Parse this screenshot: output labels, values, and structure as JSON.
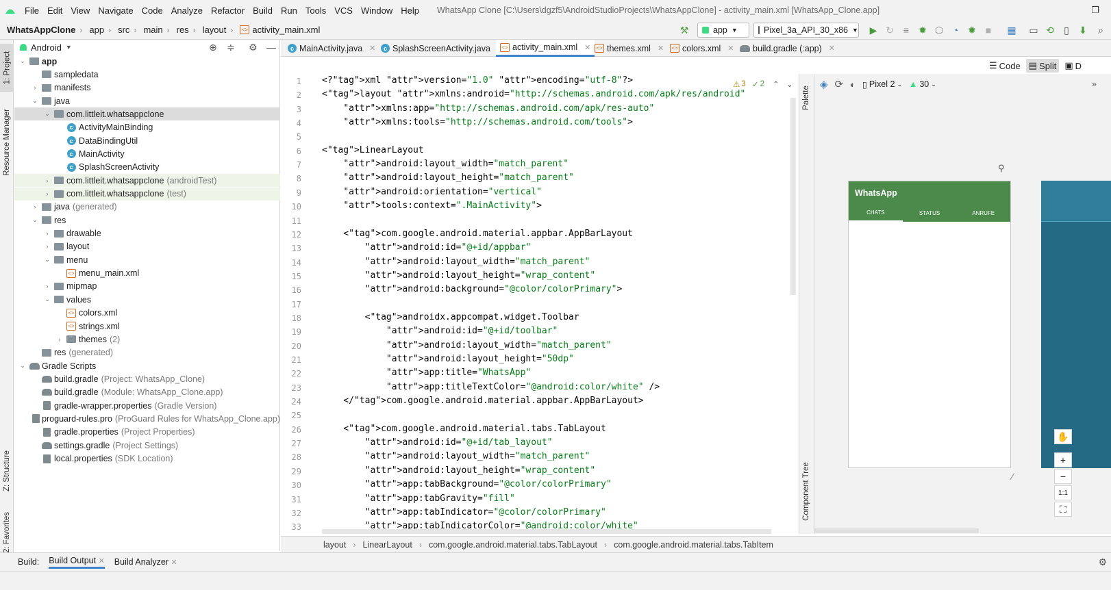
{
  "menubar": {
    "items": [
      "File",
      "Edit",
      "View",
      "Navigate",
      "Code",
      "Analyze",
      "Refactor",
      "Build",
      "Run",
      "Tools",
      "VCS",
      "Window",
      "Help"
    ],
    "window_title": "WhatsApp Clone [C:\\Users\\dgzf5\\AndroidStudioProjects\\WhatsAppClone] - activity_main.xml [WhatsApp_Clone.app]"
  },
  "navbar": {
    "crumbs": [
      "WhatsAppClone",
      "app",
      "src",
      "main",
      "res",
      "layout",
      "activity_main.xml"
    ],
    "run_config": "app",
    "device": "Pixel_3a_API_30_x86"
  },
  "leftstrip": {
    "tabs": [
      "1: Project",
      "Resource Manager",
      "Z: Structure",
      "2: Favorites"
    ]
  },
  "project": {
    "view": "Android",
    "tree": [
      {
        "label": "app",
        "hint": "",
        "icon": "folder-icon",
        "arrow": "open"
      },
      {
        "label": "sampledata",
        "hint": "",
        "icon": "folder-icon",
        "arrow": ""
      },
      {
        "label": "manifests",
        "hint": "",
        "icon": "folder-icon",
        "arrow": "closed"
      },
      {
        "label": "java",
        "hint": "",
        "icon": "folder-icon",
        "arrow": "open"
      },
      {
        "label": "com.littleit.whatsappclone",
        "hint": "",
        "icon": "package-icon",
        "arrow": "open"
      },
      {
        "label": "ActivityMainBinding",
        "hint": "",
        "icon": "class-icon",
        "arrow": ""
      },
      {
        "label": "DataBindingUtil",
        "hint": "",
        "icon": "class-icon",
        "arrow": ""
      },
      {
        "label": "MainActivity",
        "hint": "",
        "icon": "class-icon",
        "arrow": ""
      },
      {
        "label": "SplashScreenActivity",
        "hint": "",
        "icon": "class-icon",
        "arrow": ""
      },
      {
        "label": "com.littleit.whatsappclone",
        "hint": "(androidTest)",
        "icon": "package-icon",
        "arrow": "closed"
      },
      {
        "label": "com.littleit.whatsappclone",
        "hint": "(test)",
        "icon": "package-icon",
        "arrow": "closed"
      },
      {
        "label": "java",
        "hint": "(generated)",
        "icon": "folder-icon",
        "arrow": "closed"
      },
      {
        "label": "res",
        "hint": "",
        "icon": "folder-icon",
        "arrow": "open"
      },
      {
        "label": "drawable",
        "hint": "",
        "icon": "folder-icon",
        "arrow": "closed"
      },
      {
        "label": "layout",
        "hint": "",
        "icon": "folder-icon",
        "arrow": "closed"
      },
      {
        "label": "menu",
        "hint": "",
        "icon": "folder-icon",
        "arrow": "open"
      },
      {
        "label": "menu_main.xml",
        "hint": "",
        "icon": "xml-icon",
        "arrow": ""
      },
      {
        "label": "mipmap",
        "hint": "",
        "icon": "folder-icon",
        "arrow": "closed"
      },
      {
        "label": "values",
        "hint": "",
        "icon": "folder-icon",
        "arrow": "open"
      },
      {
        "label": "colors.xml",
        "hint": "",
        "icon": "xml-icon",
        "arrow": ""
      },
      {
        "label": "strings.xml",
        "hint": "",
        "icon": "xml-icon",
        "arrow": ""
      },
      {
        "label": "themes",
        "hint": "(2)",
        "icon": "folder-icon",
        "arrow": "closed"
      },
      {
        "label": "res",
        "hint": "(generated)",
        "icon": "folder-icon",
        "arrow": ""
      },
      {
        "label": "Gradle Scripts",
        "hint": "",
        "icon": "gradle-icon",
        "arrow": "open"
      },
      {
        "label": "build.gradle",
        "hint": "(Project: WhatsApp_Clone)",
        "icon": "gradle-icon",
        "arrow": ""
      },
      {
        "label": "build.gradle",
        "hint": "(Module: WhatsApp_Clone.app)",
        "icon": "gradle-icon",
        "arrow": ""
      },
      {
        "label": "gradle-wrapper.properties",
        "hint": "(Gradle Version)",
        "icon": "file-icon",
        "arrow": ""
      },
      {
        "label": "proguard-rules.pro",
        "hint": "(ProGuard Rules for WhatsApp_Clone.app)",
        "icon": "file-icon",
        "arrow": ""
      },
      {
        "label": "gradle.properties",
        "hint": "(Project Properties)",
        "icon": "file-icon",
        "arrow": ""
      },
      {
        "label": "settings.gradle",
        "hint": "(Project Settings)",
        "icon": "gradle-icon",
        "arrow": ""
      },
      {
        "label": "local.properties",
        "hint": "(SDK Location)",
        "icon": "file-icon",
        "arrow": ""
      }
    ]
  },
  "editor": {
    "tabs": [
      "MainActivity.java",
      "SplashScreenActivity.java",
      "activity_main.xml",
      "themes.xml",
      "colors.xml",
      "build.gradle (:app)"
    ],
    "active_tab": "activity_main.xml",
    "warnings": "3",
    "checks": "2",
    "lines": [
      "<?xml version=\"1.0\" encoding=\"utf-8\"?>",
      "<layout xmlns:android=\"http://schemas.android.com/apk/res/android\"",
      "    xmlns:app=\"http://schemas.android.com/apk/res-auto\"",
      "    xmlns:tools=\"http://schemas.android.com/tools\">",
      "",
      "<LinearLayout",
      "    android:layout_width=\"match_parent\"",
      "    android:layout_height=\"match_parent\"",
      "    android:orientation=\"vertical\"",
      "    tools:context=\".MainActivity\">",
      "",
      "    <com.google.android.material.appbar.AppBarLayout",
      "        android:id=\"@+id/appbar\"",
      "        android:layout_width=\"match_parent\"",
      "        android:layout_height=\"wrap_content\"",
      "        android:background=\"@color/colorPrimary\">",
      "",
      "        <androidx.appcompat.widget.Toolbar",
      "            android:id=\"@+id/toolbar\"",
      "            android:layout_width=\"match_parent\"",
      "            android:layout_height=\"50dp\"",
      "            app:title=\"WhatsApp\"",
      "            app:titleTextColor=\"@android:color/white\" />",
      "    </com.google.android.material.appbar.AppBarLayout>",
      "",
      "    <com.google.android.material.tabs.TabLayout",
      "        android:id=\"@+id/tab_layout\"",
      "        android:layout_width=\"match_parent\"",
      "        android:layout_height=\"wrap_content\"",
      "        app:tabBackground=\"@color/colorPrimary\"",
      "        app:tabGravity=\"fill\"",
      "        app:tabIndicator=\"@color/colorPrimary\"",
      "        app:tabIndicatorColor=\"@android:color/white\""
    ],
    "line_numbers": [
      "1",
      "2",
      "3",
      "4",
      "5",
      "6",
      "7",
      "8",
      "9",
      "10",
      "11",
      "12",
      "13",
      "14",
      "15",
      "16",
      "17",
      "18",
      "19",
      "20",
      "21",
      "22",
      "23",
      "24",
      "25",
      "26",
      "27",
      "28",
      "29",
      "30",
      "31",
      "32",
      "33"
    ]
  },
  "view_modes": {
    "code": "Code",
    "split": "Split",
    "design": "D"
  },
  "design": {
    "palette_label": "Palette",
    "component_tree_label": "Component Tree",
    "device": "Pixel 2",
    "api": "30",
    "preview_title": "WhatsApp",
    "preview_tabs": [
      "CHATS",
      "STATUS",
      "ANRUFE"
    ],
    "primary_color": "#4b8a4b"
  },
  "breadcrumb": [
    "layout",
    "LinearLayout",
    "com.google.android.material.tabs.TabLayout",
    "com.google.android.material.tabs.TabItem"
  ],
  "buildbar": {
    "label": "Build:",
    "tabs": [
      "Build Output",
      "Build Analyzer"
    ]
  }
}
